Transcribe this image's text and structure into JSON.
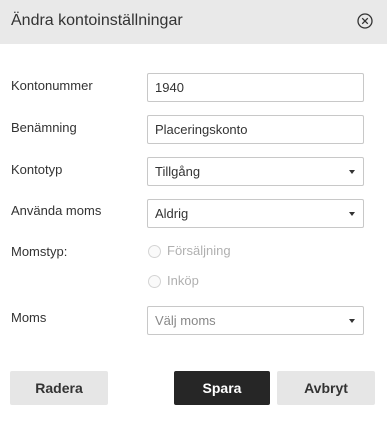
{
  "dialog": {
    "title": "Ändra kontoinställningar",
    "close_icon": "close-circle-icon"
  },
  "form": {
    "account_number": {
      "label": "Kontonummer",
      "value": "1940"
    },
    "name": {
      "label": "Benämning",
      "value": "Placeringskonto"
    },
    "account_type": {
      "label": "Kontotyp",
      "value": "Tillgång"
    },
    "use_vat": {
      "label": "Använda moms",
      "value": "Aldrig"
    },
    "vat_type": {
      "label": "Momstyp:",
      "options": [
        {
          "label": "Försäljning",
          "selected": false,
          "disabled": true
        },
        {
          "label": "Inköp",
          "selected": false,
          "disabled": true
        }
      ]
    },
    "vat": {
      "label": "Moms",
      "placeholder": "Välj moms"
    }
  },
  "buttons": {
    "delete": "Radera",
    "save": "Spara",
    "cancel": "Avbryt"
  },
  "colors": {
    "header_bg": "#e9e9e9",
    "primary_button": "#262626",
    "secondary_button": "#e6e6e6",
    "disabled_text": "#b0b0b0"
  }
}
